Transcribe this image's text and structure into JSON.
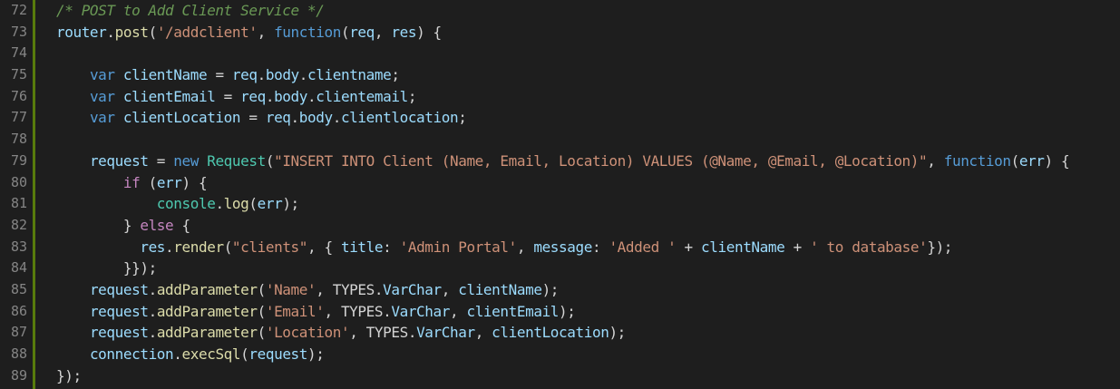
{
  "editor": {
    "lines": [
      {
        "number": "72",
        "indent": 0,
        "tokens": [
          {
            "text": "/* POST to Add Client Service */",
            "kind": "comment"
          }
        ]
      },
      {
        "number": "73",
        "indent": 0,
        "tokens": [
          {
            "text": "router",
            "kind": "var"
          },
          {
            "text": ".",
            "kind": "punc"
          },
          {
            "text": "post",
            "kind": "fn"
          },
          {
            "text": "(",
            "kind": "punc"
          },
          {
            "text": "'/addclient'",
            "kind": "str"
          },
          {
            "text": ", ",
            "kind": "punc"
          },
          {
            "text": "function",
            "kind": "kw"
          },
          {
            "text": "(",
            "kind": "punc"
          },
          {
            "text": "req",
            "kind": "var"
          },
          {
            "text": ", ",
            "kind": "punc"
          },
          {
            "text": "res",
            "kind": "var"
          },
          {
            "text": ") {",
            "kind": "punc"
          }
        ]
      },
      {
        "number": "74",
        "indent": 0,
        "tokens": []
      },
      {
        "number": "75",
        "indent": 1,
        "tokens": [
          {
            "text": "var ",
            "kind": "kw"
          },
          {
            "text": "clientName",
            "kind": "var"
          },
          {
            "text": " = ",
            "kind": "punc"
          },
          {
            "text": "req",
            "kind": "var"
          },
          {
            "text": ".",
            "kind": "punc"
          },
          {
            "text": "body",
            "kind": "var"
          },
          {
            "text": ".",
            "kind": "punc"
          },
          {
            "text": "clientname",
            "kind": "var"
          },
          {
            "text": ";",
            "kind": "punc"
          }
        ]
      },
      {
        "number": "76",
        "indent": 1,
        "tokens": [
          {
            "text": "var ",
            "kind": "kw"
          },
          {
            "text": "clientEmail",
            "kind": "var"
          },
          {
            "text": " = ",
            "kind": "punc"
          },
          {
            "text": "req",
            "kind": "var"
          },
          {
            "text": ".",
            "kind": "punc"
          },
          {
            "text": "body",
            "kind": "var"
          },
          {
            "text": ".",
            "kind": "punc"
          },
          {
            "text": "clientemail",
            "kind": "var"
          },
          {
            "text": ";",
            "kind": "punc"
          }
        ]
      },
      {
        "number": "77",
        "indent": 1,
        "tokens": [
          {
            "text": "var ",
            "kind": "kw"
          },
          {
            "text": "clientLocation",
            "kind": "var"
          },
          {
            "text": " = ",
            "kind": "punc"
          },
          {
            "text": "req",
            "kind": "var"
          },
          {
            "text": ".",
            "kind": "punc"
          },
          {
            "text": "body",
            "kind": "var"
          },
          {
            "text": ".",
            "kind": "punc"
          },
          {
            "text": "clientlocation",
            "kind": "var"
          },
          {
            "text": ";",
            "kind": "punc"
          }
        ]
      },
      {
        "number": "78",
        "indent": 0,
        "tokens": []
      },
      {
        "number": "79",
        "indent": 1,
        "tokens": [
          {
            "text": "request",
            "kind": "var"
          },
          {
            "text": " = ",
            "kind": "punc"
          },
          {
            "text": "new ",
            "kind": "kw"
          },
          {
            "text": "Request",
            "kind": "type"
          },
          {
            "text": "(",
            "kind": "punc"
          },
          {
            "text": "\"INSERT INTO Client (Name, Email, Location) VALUES (@Name, @Email, @Location)\"",
            "kind": "str"
          },
          {
            "text": ", ",
            "kind": "punc"
          },
          {
            "text": "function",
            "kind": "kw"
          },
          {
            "text": "(",
            "kind": "punc"
          },
          {
            "text": "err",
            "kind": "var"
          },
          {
            "text": ") {",
            "kind": "punc"
          }
        ]
      },
      {
        "number": "80",
        "indent": 2,
        "tokens": [
          {
            "text": "if ",
            "kind": "ctrl"
          },
          {
            "text": "(",
            "kind": "punc"
          },
          {
            "text": "err",
            "kind": "var"
          },
          {
            "text": ") {",
            "kind": "punc"
          }
        ]
      },
      {
        "number": "81",
        "indent": 3,
        "tokens": [
          {
            "text": "console",
            "kind": "type"
          },
          {
            "text": ".",
            "kind": "punc"
          },
          {
            "text": "log",
            "kind": "fn"
          },
          {
            "text": "(",
            "kind": "punc"
          },
          {
            "text": "err",
            "kind": "var"
          },
          {
            "text": ");",
            "kind": "punc"
          }
        ]
      },
      {
        "number": "82",
        "indent": 2,
        "tokens": [
          {
            "text": "} ",
            "kind": "punc"
          },
          {
            "text": "else",
            "kind": "ctrl"
          },
          {
            "text": " {",
            "kind": "punc"
          }
        ]
      },
      {
        "number": "83",
        "indent": 2,
        "extra": "  ",
        "tokens": [
          {
            "text": "res",
            "kind": "var"
          },
          {
            "text": ".",
            "kind": "punc"
          },
          {
            "text": "render",
            "kind": "fn"
          },
          {
            "text": "(",
            "kind": "punc"
          },
          {
            "text": "\"clients\"",
            "kind": "str"
          },
          {
            "text": ", { ",
            "kind": "punc"
          },
          {
            "text": "title",
            "kind": "var"
          },
          {
            "text": ": ",
            "kind": "punc"
          },
          {
            "text": "'Admin Portal'",
            "kind": "str"
          },
          {
            "text": ", ",
            "kind": "punc"
          },
          {
            "text": "message",
            "kind": "var"
          },
          {
            "text": ": ",
            "kind": "punc"
          },
          {
            "text": "'Added '",
            "kind": "str"
          },
          {
            "text": " + ",
            "kind": "punc"
          },
          {
            "text": "clientName",
            "kind": "var"
          },
          {
            "text": " + ",
            "kind": "punc"
          },
          {
            "text": "' to database'",
            "kind": "str"
          },
          {
            "text": "});",
            "kind": "punc"
          }
        ]
      },
      {
        "number": "84",
        "indent": 2,
        "tokens": [
          {
            "text": "}});",
            "kind": "punc"
          }
        ]
      },
      {
        "number": "85",
        "indent": 1,
        "tokens": [
          {
            "text": "request",
            "kind": "var"
          },
          {
            "text": ".",
            "kind": "punc"
          },
          {
            "text": "addParameter",
            "kind": "fn"
          },
          {
            "text": "(",
            "kind": "punc"
          },
          {
            "text": "'Name'",
            "kind": "str"
          },
          {
            "text": ", ",
            "kind": "punc"
          },
          {
            "text": "TYPES",
            "kind": "punc"
          },
          {
            "text": ".",
            "kind": "punc"
          },
          {
            "text": "VarChar",
            "kind": "var"
          },
          {
            "text": ", ",
            "kind": "punc"
          },
          {
            "text": "clientName",
            "kind": "var"
          },
          {
            "text": ");",
            "kind": "punc"
          }
        ]
      },
      {
        "number": "86",
        "indent": 1,
        "tokens": [
          {
            "text": "request",
            "kind": "var"
          },
          {
            "text": ".",
            "kind": "punc"
          },
          {
            "text": "addParameter",
            "kind": "fn"
          },
          {
            "text": "(",
            "kind": "punc"
          },
          {
            "text": "'Email'",
            "kind": "str"
          },
          {
            "text": ", ",
            "kind": "punc"
          },
          {
            "text": "TYPES",
            "kind": "punc"
          },
          {
            "text": ".",
            "kind": "punc"
          },
          {
            "text": "VarChar",
            "kind": "var"
          },
          {
            "text": ", ",
            "kind": "punc"
          },
          {
            "text": "clientEmail",
            "kind": "var"
          },
          {
            "text": ");",
            "kind": "punc"
          }
        ]
      },
      {
        "number": "87",
        "indent": 1,
        "tokens": [
          {
            "text": "request",
            "kind": "var"
          },
          {
            "text": ".",
            "kind": "punc"
          },
          {
            "text": "addParameter",
            "kind": "fn"
          },
          {
            "text": "(",
            "kind": "punc"
          },
          {
            "text": "'Location'",
            "kind": "str"
          },
          {
            "text": ", ",
            "kind": "punc"
          },
          {
            "text": "TYPES",
            "kind": "punc"
          },
          {
            "text": ".",
            "kind": "punc"
          },
          {
            "text": "VarChar",
            "kind": "var"
          },
          {
            "text": ", ",
            "kind": "punc"
          },
          {
            "text": "clientLocation",
            "kind": "var"
          },
          {
            "text": ");",
            "kind": "punc"
          }
        ]
      },
      {
        "number": "88",
        "indent": 1,
        "tokens": [
          {
            "text": "connection",
            "kind": "var"
          },
          {
            "text": ".",
            "kind": "punc"
          },
          {
            "text": "execSql",
            "kind": "fn"
          },
          {
            "text": "(",
            "kind": "punc"
          },
          {
            "text": "request",
            "kind": "var"
          },
          {
            "text": ");",
            "kind": "punc"
          }
        ]
      },
      {
        "number": "89",
        "indent": 0,
        "tokens": [
          {
            "text": "});",
            "kind": "punc"
          }
        ]
      }
    ]
  }
}
